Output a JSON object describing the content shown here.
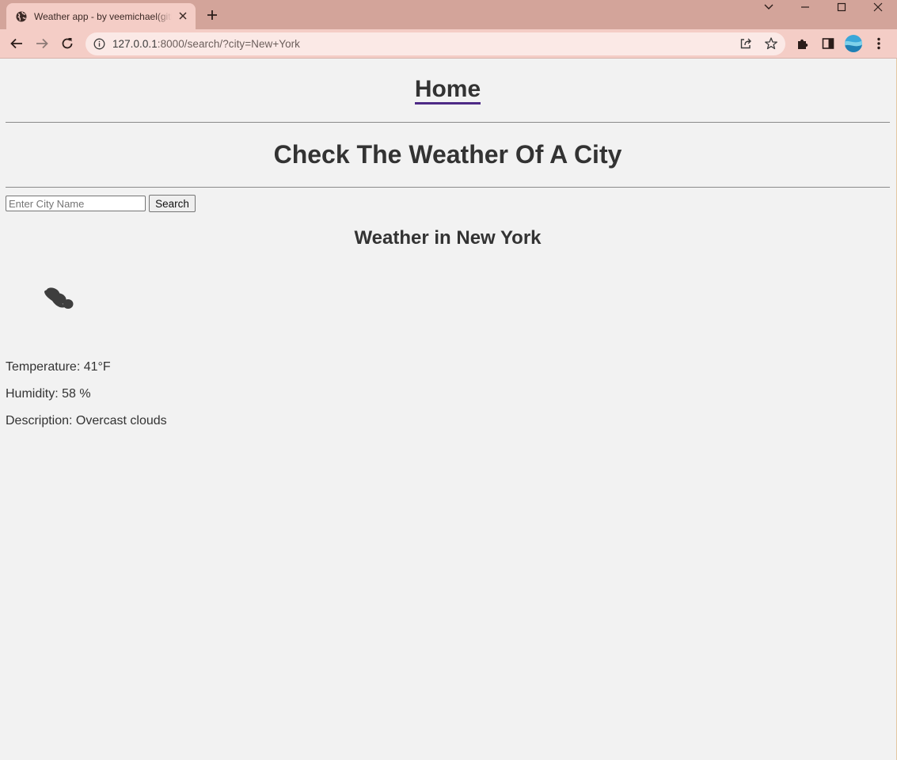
{
  "browser": {
    "tab_title": "Weather app - by veemichael(github)",
    "url_host": "127.0.0.1",
    "url_rest": ":8000/search/?city=New+York"
  },
  "nav": {
    "home_label": "Home"
  },
  "main": {
    "heading": "Check The Weather Of A City",
    "search": {
      "placeholder": "Enter City Name",
      "value": "",
      "button_label": "Search"
    },
    "weather_title": "Weather in New York",
    "weather_icon": "overcast-clouds-icon",
    "temperature": "Temperature: 41°F",
    "humidity": "Humidity: 58 %",
    "description": "Description: Overcast clouds"
  }
}
